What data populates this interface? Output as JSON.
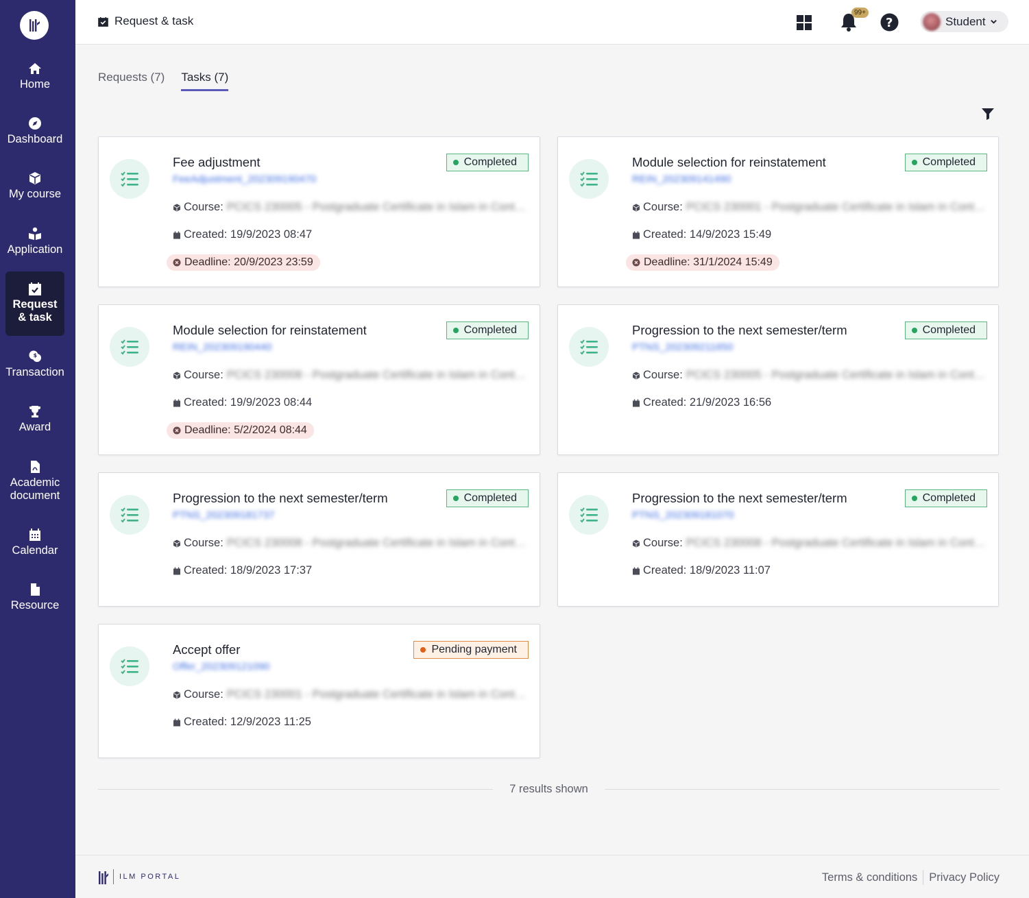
{
  "sidebar": {
    "items": [
      {
        "label": "Home",
        "icon": "home-icon"
      },
      {
        "label": "Dashboard",
        "icon": "compass-icon"
      },
      {
        "label": "My course",
        "icon": "cube-icon"
      },
      {
        "label": "Application",
        "icon": "application-icon"
      },
      {
        "label": "Request & task",
        "icon": "calendar-check-icon",
        "active": true
      },
      {
        "label": "Transaction",
        "icon": "transaction-icon"
      },
      {
        "label": "Award",
        "icon": "trophy-icon"
      },
      {
        "label": "Academic document",
        "icon": "pdf-file-icon"
      },
      {
        "label": "Calendar",
        "icon": "calendar-icon"
      },
      {
        "label": "Resource",
        "icon": "file-icon"
      }
    ]
  },
  "header": {
    "breadcrumb": "Request & task",
    "notification_badge": "99+",
    "user_label": "Student"
  },
  "tabs": [
    {
      "label": "Requests (7)",
      "active": false
    },
    {
      "label": "Tasks (7)",
      "active": true
    }
  ],
  "labels": {
    "course": "Course:",
    "created": "Created:",
    "deadline": "Deadline:"
  },
  "tasks": [
    {
      "title": "Fee adjustment",
      "ref": "FeeAdjustment_202309190470",
      "status": "Completed",
      "course": "PCICS 230005 - Postgraduate Certificate in Islam in Conte...",
      "created": "19/9/2023 08:47",
      "deadline": "20/9/2023 23:59"
    },
    {
      "title": "Module selection for reinstatement",
      "ref": "REIN_202309141490",
      "status": "Completed",
      "course": "PCICS 230001 - Postgraduate Certificate in Islam in Conte...",
      "created": "14/9/2023 15:49",
      "deadline": "31/1/2024 15:49"
    },
    {
      "title": "Module selection for reinstatement",
      "ref": "REIN_202309190440",
      "status": "Completed",
      "course": "PCICS 230008 - Postgraduate Certificate in Islam in Conte...",
      "created": "19/9/2023 08:44",
      "deadline": "5/2/2024 08:44"
    },
    {
      "title": "Progression to the next semester/term",
      "ref": "PTNS_202309211650",
      "status": "Completed",
      "course": "PCICS 230005 - Postgraduate Certificate in Islam in Conte...",
      "created": "21/9/2023 16:56",
      "deadline": null
    },
    {
      "title": "Progression to the next semester/term",
      "ref": "PTNS_202309181737",
      "status": "Completed",
      "course": "PCICS 230008 - Postgraduate Certificate in Islam in Conte...",
      "created": "18/9/2023 17:37",
      "deadline": null
    },
    {
      "title": "Progression to the next semester/term",
      "ref": "PTNS_202309181070",
      "status": "Completed",
      "course": "PCICS 230008 - Postgraduate Certificate in Islam in Conte...",
      "created": "18/9/2023 11:07",
      "deadline": null
    },
    {
      "title": "Accept offer",
      "ref": "Offer_202309121090",
      "status": "Pending payment",
      "course": "PCICS 230001 - Postgraduate Certificate in Islam in Conte...",
      "created": "12/9/2023 11:25",
      "deadline": null
    }
  ],
  "results_text": "7 results shown",
  "footer": {
    "brand": "ILM PORTAL",
    "links": [
      "Terms & conditions",
      "Privacy Policy"
    ]
  },
  "colors": {
    "sidebar_bg": "#2d2a6e",
    "active_nav_bg": "#1c1d3b",
    "completed_green": "#25a55f",
    "pending_orange": "#e0601a",
    "deadline_bg": "#fbe4e4",
    "tab_underline": "#5a5bb8"
  }
}
